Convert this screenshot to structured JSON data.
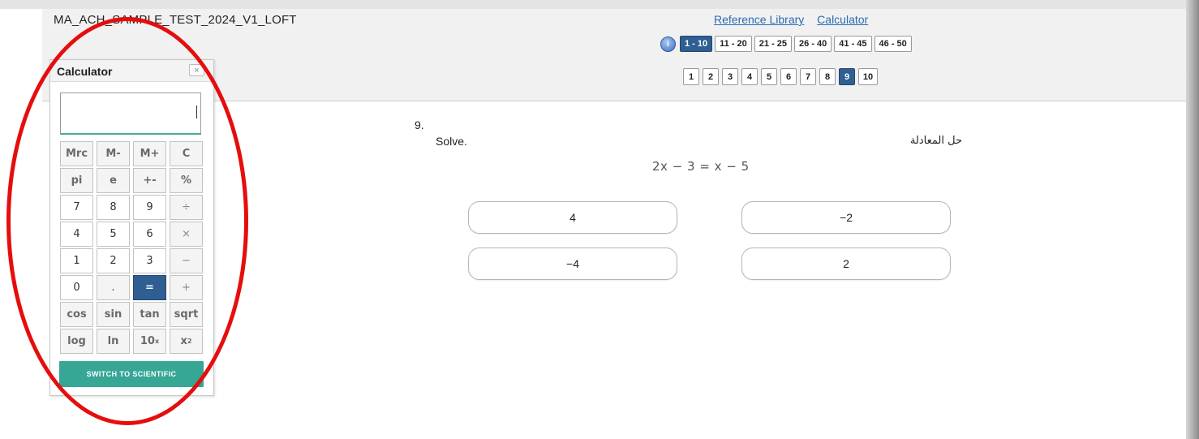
{
  "header": {
    "test_title": "MA_ACH_SAMPLE_TEST_2024_V1_LOFT",
    "links": {
      "reference_library": "Reference Library",
      "calculator": "Calculator"
    },
    "info_icon": "i",
    "ranges": [
      "1 - 10",
      "11 - 20",
      "21 - 25",
      "26 - 40",
      "41 - 45",
      "46 - 50"
    ],
    "active_range": "1 - 10",
    "question_numbers": [
      "1",
      "2",
      "3",
      "4",
      "5",
      "6",
      "7",
      "8",
      "9",
      "10"
    ],
    "active_question": "9"
  },
  "calculator": {
    "title": "Calculator",
    "close_label": "×",
    "display_value": "",
    "keys": {
      "mrc": "Mrc",
      "m_minus": "M-",
      "m_plus": "M+",
      "clear": "C",
      "pi": "pi",
      "e": "e",
      "plus_minus": "+-",
      "percent": "%",
      "seven": "7",
      "eight": "8",
      "nine": "9",
      "divide": "÷",
      "four": "4",
      "five": "5",
      "six": "6",
      "multiply": "×",
      "one": "1",
      "two": "2",
      "three": "3",
      "minus": "−",
      "zero": "0",
      "decimal": ".",
      "equals": "=",
      "plus": "+",
      "cos": "cos",
      "sin": "sin",
      "tan": "tan",
      "sqrt": "sqrt",
      "log": "log",
      "ln": "ln",
      "ten_pow_base": "10",
      "ten_pow_exp": "x",
      "x_sq_base": "x",
      "x_sq_exp": "2"
    },
    "switch_label": "SWITCH TO SCIENTIFIC"
  },
  "question": {
    "number": "9.",
    "prompt": "Solve.",
    "prompt_ar": "حل المعادلة",
    "equation": "2x − 3 = x − 5",
    "answers": [
      "4",
      "−2",
      "−4",
      "2"
    ]
  },
  "colors": {
    "active_blue": "#2f5f92",
    "link_blue": "#2a6bb5",
    "switch_teal": "#36a695",
    "annotation_red": "#e60d0d"
  }
}
